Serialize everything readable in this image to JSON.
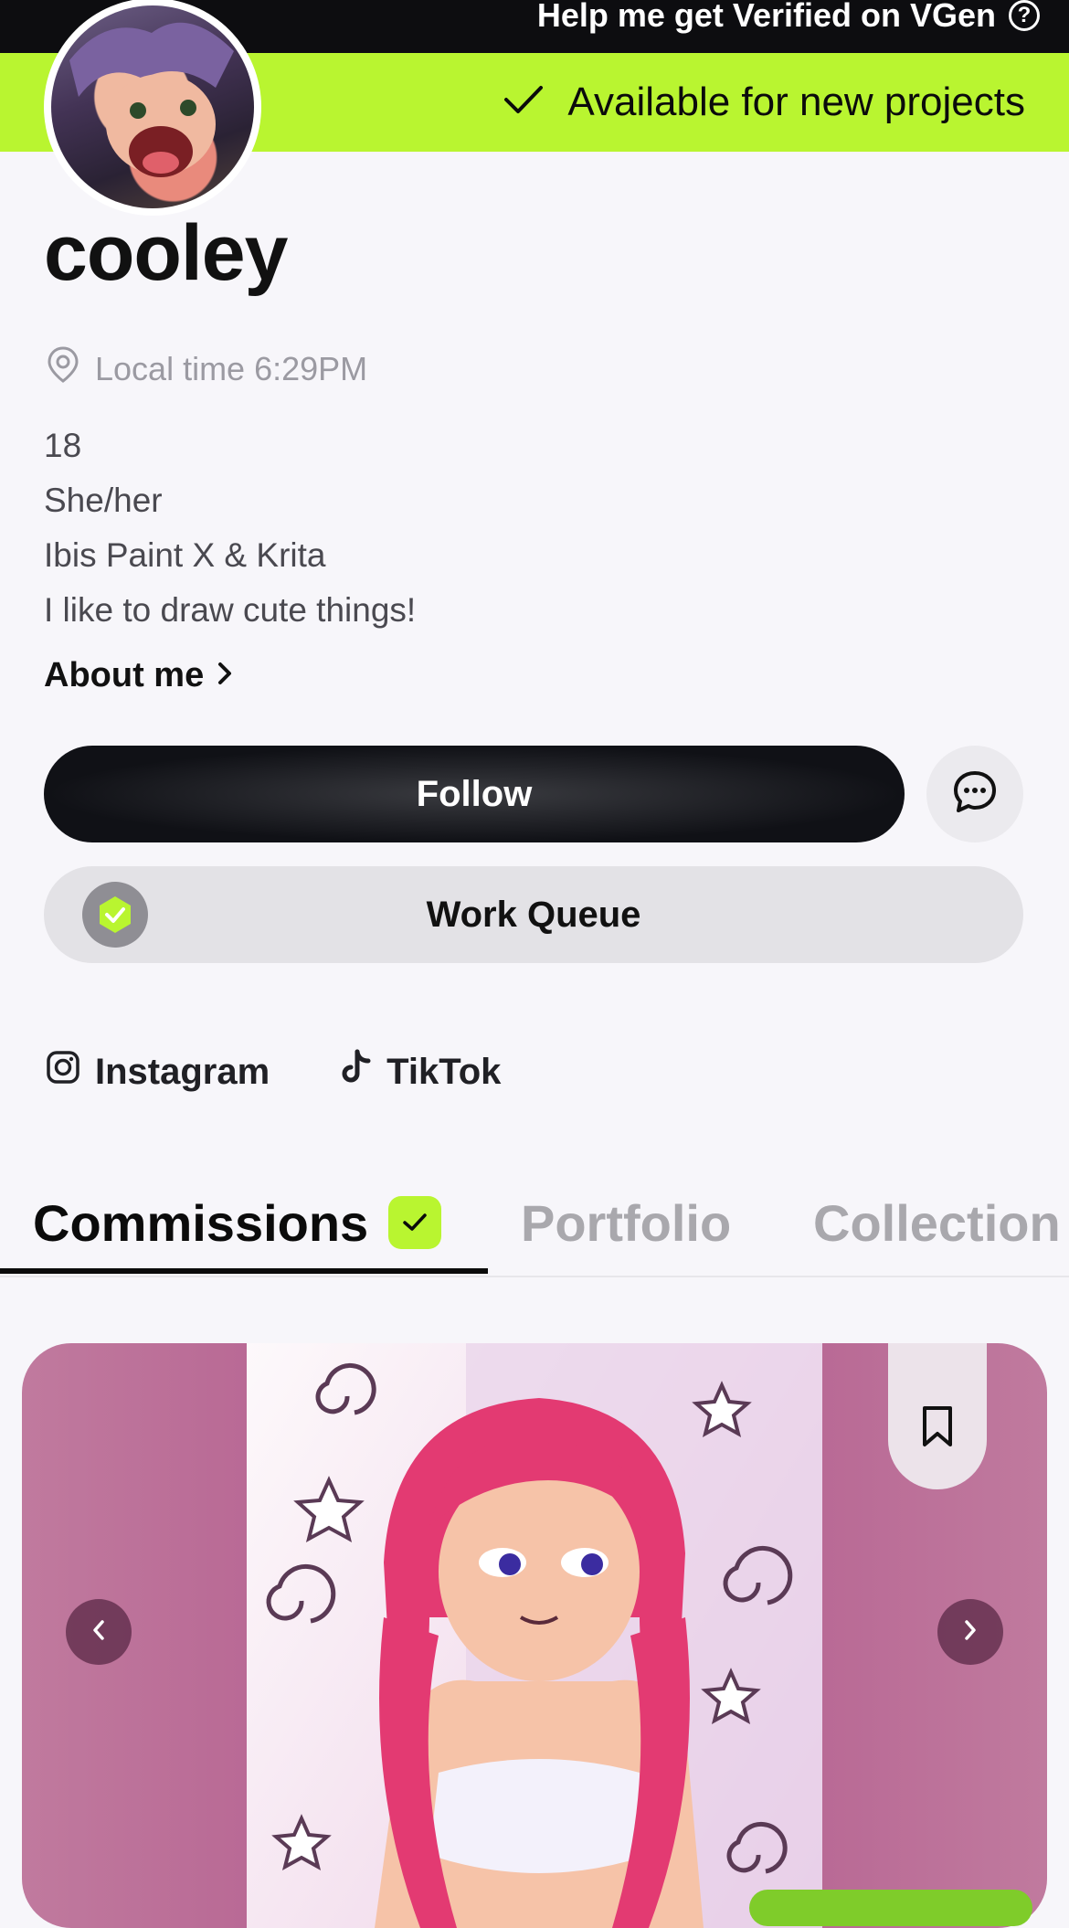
{
  "header": {
    "verify_text": "Help me get Verified on VGen",
    "verify_help_glyph": "?",
    "availability_text": "Available for new projects"
  },
  "profile": {
    "username": "cooley",
    "local_time": "Local time 6:29PM",
    "bio_lines": [
      "18",
      "She/her",
      "Ibis Paint X & Krita",
      "I like to draw cute things!"
    ],
    "about_label": "About me",
    "follow_label": "Follow",
    "work_queue_label": "Work Queue"
  },
  "socials": [
    {
      "label": "Instagram",
      "icon": "instagram-icon"
    },
    {
      "label": "TikTok",
      "icon": "tiktok-icon"
    }
  ],
  "tabs": [
    {
      "label": "Commissions",
      "active": true
    },
    {
      "label": "Portfolio",
      "active": false
    },
    {
      "label": "Collection",
      "active": false
    }
  ],
  "colors": {
    "accent": "#b9f530",
    "topbar": "#0d0d10",
    "card_bg": "#b0558a"
  }
}
